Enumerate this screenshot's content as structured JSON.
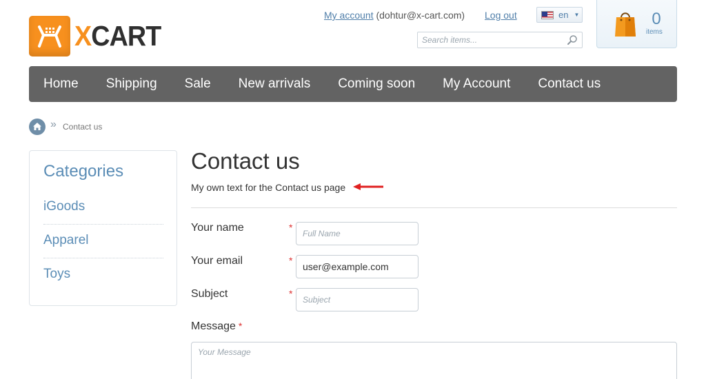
{
  "header": {
    "logo": {
      "x_letter": "X",
      "rest": "CART"
    },
    "account": {
      "link": "My account",
      "email": "(dohtur@x-cart.com)"
    },
    "logout": "Log out",
    "language": "en",
    "search_placeholder": "Search items...",
    "cart": {
      "count": "0",
      "label": "items"
    }
  },
  "nav": {
    "items": [
      {
        "label": "Home"
      },
      {
        "label": "Shipping"
      },
      {
        "label": "Sale"
      },
      {
        "label": "New arrivals"
      },
      {
        "label": "Coming soon"
      },
      {
        "label": "My Account"
      },
      {
        "label": "Contact us"
      }
    ]
  },
  "breadcrumb": {
    "separator": "»",
    "current": "Contact us"
  },
  "sidebar": {
    "title": "Categories",
    "items": [
      {
        "label": "iGoods"
      },
      {
        "label": "Apparel"
      },
      {
        "label": "Toys"
      }
    ]
  },
  "main": {
    "title": "Contact us",
    "intro": "My own text for the Contact us page",
    "form": {
      "name_label": "Your name",
      "name_placeholder": "Full Name",
      "email_label": "Your email",
      "email_value": "user@example.com",
      "subject_label": "Subject",
      "subject_placeholder": "Subject",
      "message_label": "Message",
      "message_placeholder": "Your Message",
      "required_mark": "*"
    }
  },
  "colors": {
    "brand_orange": "#f7901e",
    "nav_bg": "#636363",
    "link_blue": "#5b8db6",
    "annotation_arrow": "#e02020"
  }
}
